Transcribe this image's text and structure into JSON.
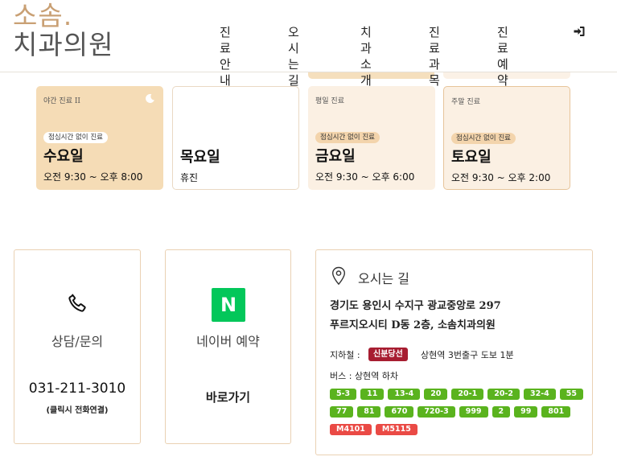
{
  "header": {
    "logo_top": "소솜.",
    "logo_bottom": "치과의원",
    "nav": [
      "진료안내",
      "오시는 길",
      "치과소개",
      "진료과목",
      "진료예약"
    ]
  },
  "hours": [
    {
      "tag": "야간 진료 II",
      "badge": "점심시간 없이 진료",
      "day": "수요일",
      "time": "오전 9:30 ~ 오후 8:00",
      "icon": "moon-icon"
    },
    {
      "tag": "",
      "badge": "",
      "day": "목요일",
      "time": "휴진"
    },
    {
      "tag": "평일 진료",
      "badge": "점심시간 없이 진료",
      "day": "금요일",
      "time": "오전 9:30 ~ 오후 6:00"
    },
    {
      "tag": "주말 진료",
      "badge": "점심시간 없이 진료",
      "day": "토요일",
      "time": "오전 9:30 ~ 오후 2:00"
    }
  ],
  "contact": {
    "title": "상담/문의",
    "phone": "031-211-3010",
    "note": "(클릭시 전화연결)"
  },
  "naver": {
    "logo_letter": "N",
    "title": "네이버 예약",
    "link": "바로가기"
  },
  "location": {
    "title": "오시는 길",
    "address_line1": "경기도 용인시 수지구 광교중앙로 297",
    "address_line2": "푸르지오시티 D동 2층, 소솜치과의원",
    "subway_label": "지하철 :",
    "subway_line": "신분당선",
    "subway_text": "상현역 3번출구 도보 1분",
    "bus_label": "버스 : 상현역 하차",
    "green_buses_row1": [
      "5-3",
      "11",
      "13-4",
      "20",
      "20-1",
      "20-2",
      "32-4",
      "55"
    ],
    "green_buses_row2": [
      "77",
      "81",
      "670",
      "720-3",
      "999",
      "2",
      "99",
      "801"
    ],
    "red_buses": [
      "M4101",
      "M5115"
    ]
  },
  "colors": {
    "accent": "#c9a074",
    "wed_card": "#f5dcb6",
    "light_card": "#fbf0e3",
    "subway": "#a71d31",
    "bus_green": "#5ab31e",
    "bus_red": "#ea4a45",
    "naver": "#03c75a"
  }
}
